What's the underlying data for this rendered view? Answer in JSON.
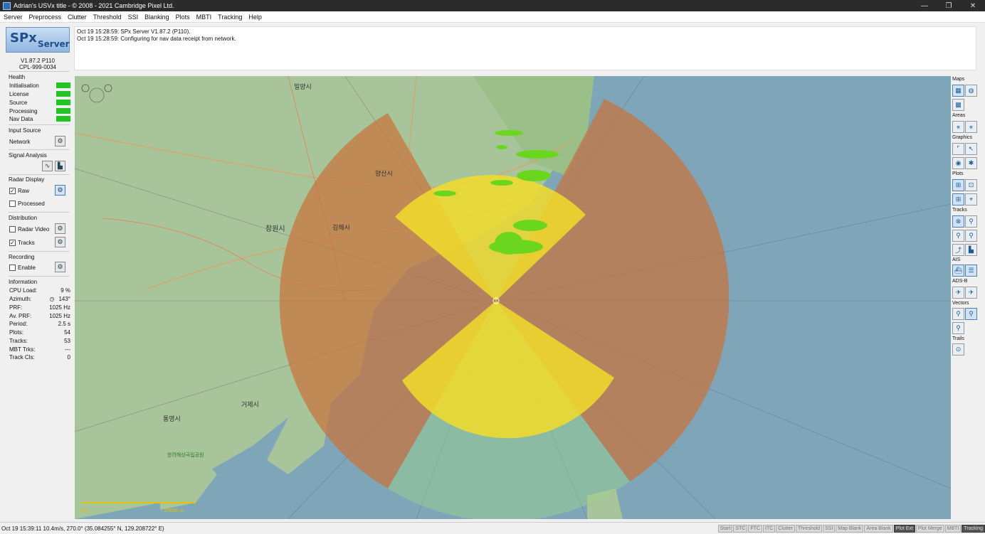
{
  "window": {
    "title": "Adrian's USVx title - © 2008 - 2021 Cambridge Pixel Ltd.",
    "minimize": "—",
    "maximize": "❐",
    "close": "✕"
  },
  "menu": [
    "Server",
    "Preprocess",
    "Clutter",
    "Threshold",
    "SSI",
    "Blanking",
    "Plots",
    "MBTI",
    "Tracking",
    "Help"
  ],
  "logo": {
    "main": "SPx",
    "sub": "Server"
  },
  "version": "V1.87.2 P110",
  "serial": "CPL-999-0034",
  "health": {
    "title": "Health",
    "items": [
      {
        "label": "Initialisation",
        "color": "#22c422"
      },
      {
        "label": "License",
        "color": "#22c422"
      },
      {
        "label": "Source",
        "color": "#22c422"
      },
      {
        "label": "Processing",
        "color": "#22c422"
      },
      {
        "label": "Nav Data",
        "color": "#22c422"
      }
    ]
  },
  "input_source": {
    "title": "Input Source",
    "label": "Network"
  },
  "signal_analysis": {
    "title": "Signal Analysis"
  },
  "radar_display": {
    "title": "Radar Display",
    "raw": "Raw",
    "raw_checked": true,
    "processed": "Processed",
    "processed_checked": false
  },
  "distribution": {
    "title": "Distribution",
    "radar_video": "Radar Video",
    "radar_video_checked": false,
    "tracks": "Tracks",
    "tracks_checked": true
  },
  "recording": {
    "title": "Recording",
    "enable": "Enable",
    "enable_checked": false
  },
  "information": {
    "title": "Information",
    "rows": [
      {
        "label": "CPU Load:",
        "value": "9 %"
      },
      {
        "label": "Azimuth:",
        "value": "143°"
      },
      {
        "label": "PRF:",
        "value": "1025 Hz"
      },
      {
        "label": "Av. PRF:",
        "value": "1025 Hz"
      },
      {
        "label": "Period:",
        "value": "2.5 s"
      },
      {
        "label": "Plots:",
        "value": "54"
      },
      {
        "label": "Tracks:",
        "value": "53"
      },
      {
        "label": "MBT Trks:",
        "value": "---"
      },
      {
        "label": "Track Cls:",
        "value": "0"
      }
    ]
  },
  "log": [
    "Oct 19 15:28:59: SPx Server V1.87.2 (P110).",
    "Oct 19 15:28:59: Configuring for nav data receipt from network."
  ],
  "map": {
    "labels": [
      "밀양시",
      "양산시",
      "창원시",
      "김해시",
      "거제시",
      "통영시",
      "한려해상국립공원"
    ],
    "scale_start": "0 m",
    "scale_end": "20000 m",
    "colors": {
      "sea": "#7fa6b8",
      "land": "#a8c49a",
      "orange_sector": "#c8733c",
      "yellow_sector": "#f2dc2a",
      "green_sector": "#9cd48a",
      "plots": "#6bd61e"
    }
  },
  "right_panel": {
    "groups": [
      "Maps",
      "Areas",
      "Graphics",
      "Plots",
      "Tracks",
      "AIS",
      "ADS-B",
      "Vectors",
      "Trails"
    ]
  },
  "status": {
    "text": "Oct 19 15:39:11  10.4m/s, 270.0° (35.084255° N, 129.208722° E)",
    "buttons": [
      {
        "label": "Start",
        "active": false
      },
      {
        "label": "STC",
        "active": false
      },
      {
        "label": "FTC",
        "active": false
      },
      {
        "label": "ITC",
        "active": false
      },
      {
        "label": "Clutter",
        "active": false
      },
      {
        "label": "Threshold",
        "active": false
      },
      {
        "label": "SSI",
        "active": false
      },
      {
        "label": "Map Blank",
        "active": false
      },
      {
        "label": "Area Blank",
        "active": false
      },
      {
        "label": "Plot Ext",
        "active": true
      },
      {
        "label": "Plot Merge",
        "active": false
      },
      {
        "label": "MBTI",
        "active": false
      },
      {
        "label": "Tracking",
        "active": true
      }
    ]
  }
}
